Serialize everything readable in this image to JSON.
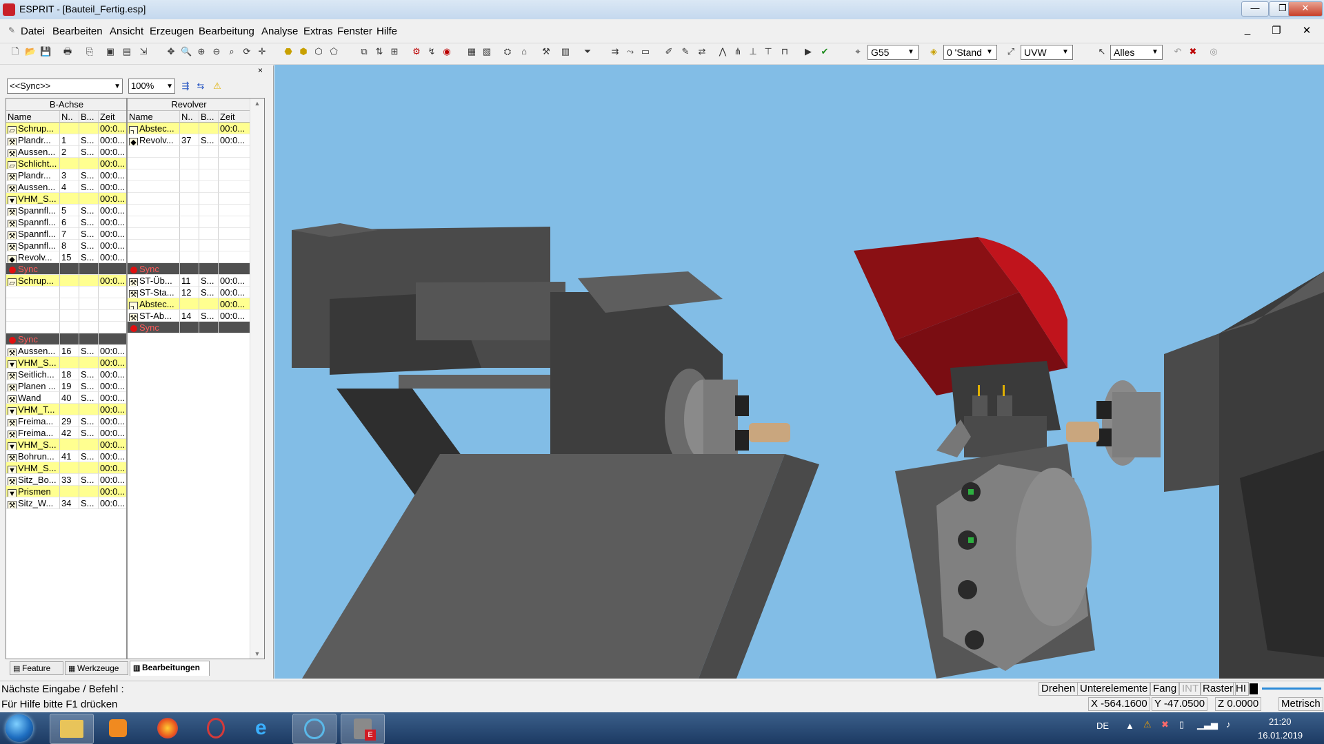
{
  "window": {
    "title": "ESPRIT - [Bauteil_Fertig.esp]",
    "minimize": "—",
    "restore": "❐",
    "close": "✕"
  },
  "menu": {
    "items": [
      "Datei",
      "Bearbeiten",
      "Ansicht",
      "Erzeugen",
      "Bearbeitung",
      "Analyse",
      "Extras",
      "Fenster",
      "Hilfe"
    ],
    "mdi_minimize": "_",
    "mdi_restore": "❐",
    "mdi_close": "✕"
  },
  "toolbar": {
    "work_offset": "G55",
    "layer": "0 'Stand",
    "coordinate": "UVW",
    "selection_filter": "Alles"
  },
  "left_panel": {
    "sync_filter": "<<Sync>>",
    "zoom": "100%",
    "close": "×",
    "columns": [
      "Name",
      "N..",
      "B...",
      "Zeit"
    ],
    "groups": {
      "left": "B-Achse",
      "right": "Revolver"
    },
    "left_rows": [
      {
        "name": "Schrup...",
        "n": "",
        "b": "",
        "zeit": "00:0...",
        "style": "yellow",
        "icon": "feature-icon"
      },
      {
        "name": "Plandr...",
        "n": "1",
        "b": "S...",
        "zeit": "00:0...",
        "style": "",
        "icon": "tool-icon"
      },
      {
        "name": "Aussen...",
        "n": "2",
        "b": "S...",
        "zeit": "00:0...",
        "style": "",
        "icon": "tool-icon"
      },
      {
        "name": "Schlicht...",
        "n": "",
        "b": "",
        "zeit": "00:0...",
        "style": "yellow",
        "icon": "feature-icon"
      },
      {
        "name": "Plandr...",
        "n": "3",
        "b": "S...",
        "zeit": "00:0...",
        "style": "",
        "icon": "tool-icon"
      },
      {
        "name": "Aussen...",
        "n": "4",
        "b": "S...",
        "zeit": "00:0...",
        "style": "",
        "icon": "tool-icon"
      },
      {
        "name": "VHM_S...",
        "n": "",
        "b": "",
        "zeit": "00:0...",
        "style": "yellow",
        "icon": "drill-icon"
      },
      {
        "name": "Spannfl...",
        "n": "5",
        "b": "S...",
        "zeit": "00:0...",
        "style": "",
        "icon": "tool-icon"
      },
      {
        "name": "Spannfl...",
        "n": "6",
        "b": "S...",
        "zeit": "00:0...",
        "style": "",
        "icon": "tool-icon"
      },
      {
        "name": "Spannfl...",
        "n": "7",
        "b": "S...",
        "zeit": "00:0...",
        "style": "",
        "icon": "tool-icon"
      },
      {
        "name": "Spannfl...",
        "n": "8",
        "b": "S...",
        "zeit": "00:0...",
        "style": "",
        "icon": "tool-icon"
      },
      {
        "name": "Revolv...",
        "n": "15",
        "b": "S...",
        "zeit": "00:0...",
        "style": "",
        "icon": "turret-icon"
      },
      {
        "name": "Sync",
        "n": "",
        "b": "",
        "zeit": "",
        "style": "sync",
        "icon": "sync-icon"
      },
      {
        "name": "Schrup...",
        "n": "",
        "b": "",
        "zeit": "00:0...",
        "style": "yellow",
        "icon": "feature-icon"
      },
      {
        "name": "",
        "n": "",
        "b": "",
        "zeit": "",
        "style": "",
        "icon": ""
      },
      {
        "name": "",
        "n": "",
        "b": "",
        "zeit": "",
        "style": "",
        "icon": ""
      },
      {
        "name": "",
        "n": "",
        "b": "",
        "zeit": "",
        "style": "",
        "icon": ""
      },
      {
        "name": "",
        "n": "",
        "b": "",
        "zeit": "",
        "style": "",
        "icon": ""
      },
      {
        "name": "Sync",
        "n": "",
        "b": "",
        "zeit": "",
        "style": "sync",
        "icon": "sync-icon"
      },
      {
        "name": "Aussen...",
        "n": "16",
        "b": "S...",
        "zeit": "00:0...",
        "style": "",
        "icon": "tool-icon"
      },
      {
        "name": "VHM_S...",
        "n": "",
        "b": "",
        "zeit": "00:0...",
        "style": "yellow",
        "icon": "drill-icon"
      },
      {
        "name": "Seitlich...",
        "n": "18",
        "b": "S...",
        "zeit": "00:0...",
        "style": "",
        "icon": "tool-icon"
      },
      {
        "name": "Planen ...",
        "n": "19",
        "b": "S...",
        "zeit": "00:0...",
        "style": "",
        "icon": "tool-icon"
      },
      {
        "name": "Wand",
        "n": "40",
        "b": "S...",
        "zeit": "00:0...",
        "style": "",
        "icon": "tool-icon"
      },
      {
        "name": "VHM_T...",
        "n": "",
        "b": "",
        "zeit": "00:0...",
        "style": "yellow",
        "icon": "drill-icon"
      },
      {
        "name": "Freima...",
        "n": "29",
        "b": "S...",
        "zeit": "00:0...",
        "style": "",
        "icon": "tool-icon"
      },
      {
        "name": "Freima...",
        "n": "42",
        "b": "S...",
        "zeit": "00:0...",
        "style": "",
        "icon": "tool-icon"
      },
      {
        "name": "VHM_S...",
        "n": "",
        "b": "",
        "zeit": "00:0...",
        "style": "yellow",
        "icon": "drill-icon"
      },
      {
        "name": "Bohrun...",
        "n": "41",
        "b": "S...",
        "zeit": "00:0...",
        "style": "",
        "icon": "tool-icon"
      },
      {
        "name": "VHM_S...",
        "n": "",
        "b": "",
        "zeit": "00:0...",
        "style": "yellow",
        "icon": "drill-icon"
      },
      {
        "name": "Sitz_Bo...",
        "n": "33",
        "b": "S...",
        "zeit": "00:0...",
        "style": "",
        "icon": "tool-icon"
      },
      {
        "name": "Prismen",
        "n": "",
        "b": "",
        "zeit": "00:0...",
        "style": "yellow",
        "icon": "drill-icon"
      },
      {
        "name": "Sitz_W...",
        "n": "34",
        "b": "S...",
        "zeit": "00:0...",
        "style": "",
        "icon": "tool-icon"
      }
    ],
    "right_rows": [
      {
        "name": "Abstec...",
        "n": "",
        "b": "",
        "zeit": "00:0...",
        "style": "yellow",
        "icon": "parting-icon"
      },
      {
        "name": "Revolv...",
        "n": "37",
        "b": "S...",
        "zeit": "00:0...",
        "style": "",
        "icon": "turret-icon"
      },
      {
        "name": "",
        "n": "",
        "b": "",
        "zeit": "",
        "style": "",
        "icon": ""
      },
      {
        "name": "",
        "n": "",
        "b": "",
        "zeit": "",
        "style": "",
        "icon": ""
      },
      {
        "name": "",
        "n": "",
        "b": "",
        "zeit": "",
        "style": "",
        "icon": ""
      },
      {
        "name": "",
        "n": "",
        "b": "",
        "zeit": "",
        "style": "",
        "icon": ""
      },
      {
        "name": "",
        "n": "",
        "b": "",
        "zeit": "",
        "style": "",
        "icon": ""
      },
      {
        "name": "",
        "n": "",
        "b": "",
        "zeit": "",
        "style": "",
        "icon": ""
      },
      {
        "name": "",
        "n": "",
        "b": "",
        "zeit": "",
        "style": "",
        "icon": ""
      },
      {
        "name": "",
        "n": "",
        "b": "",
        "zeit": "",
        "style": "",
        "icon": ""
      },
      {
        "name": "",
        "n": "",
        "b": "",
        "zeit": "",
        "style": "",
        "icon": ""
      },
      {
        "name": "",
        "n": "",
        "b": "",
        "zeit": "",
        "style": "",
        "icon": ""
      },
      {
        "name": "Sync",
        "n": "",
        "b": "",
        "zeit": "",
        "style": "sync",
        "icon": "sync-icon"
      },
      {
        "name": "ST-Üb...",
        "n": "11",
        "b": "S...",
        "zeit": "00:0...",
        "style": "",
        "icon": "tool-icon"
      },
      {
        "name": "ST-Sta...",
        "n": "12",
        "b": "S...",
        "zeit": "00:0...",
        "style": "",
        "icon": "tool-icon"
      },
      {
        "name": "Abstec...",
        "n": "",
        "b": "",
        "zeit": "00:0...",
        "style": "yellow",
        "icon": "parting-icon"
      },
      {
        "name": "ST-Ab...",
        "n": "14",
        "b": "S...",
        "zeit": "00:0...",
        "style": "",
        "icon": "tool-icon"
      },
      {
        "name": "Sync",
        "n": "",
        "b": "",
        "zeit": "",
        "style": "sync",
        "icon": "sync-icon"
      }
    ],
    "tabs": [
      {
        "label": "Feature",
        "active": false
      },
      {
        "label": "Werkzeuge",
        "active": false
      },
      {
        "label": "Bearbeitungen",
        "active": true
      }
    ]
  },
  "status": {
    "prompt": "Nächste Eingabe / Befehl :",
    "help": "Für Hilfe bitte F1 drücken",
    "mode": "Drehen",
    "sub_elements": "Unterelemente",
    "snap": "Fang",
    "int": "INT",
    "grid": "Raster",
    "hi": "HI",
    "x": "X -564.1600",
    "y": "Y -47.0500",
    "z": "Z 0.0000",
    "units": "Metrisch"
  },
  "taskbar": {
    "language": "DE",
    "time": "21:20",
    "date": "16.01.2019"
  },
  "colors": {
    "viewport_bg": "#82bde6",
    "machine_dark": "#3c3c3c",
    "machine_mid": "#707070",
    "head_red": "#c0141c"
  }
}
